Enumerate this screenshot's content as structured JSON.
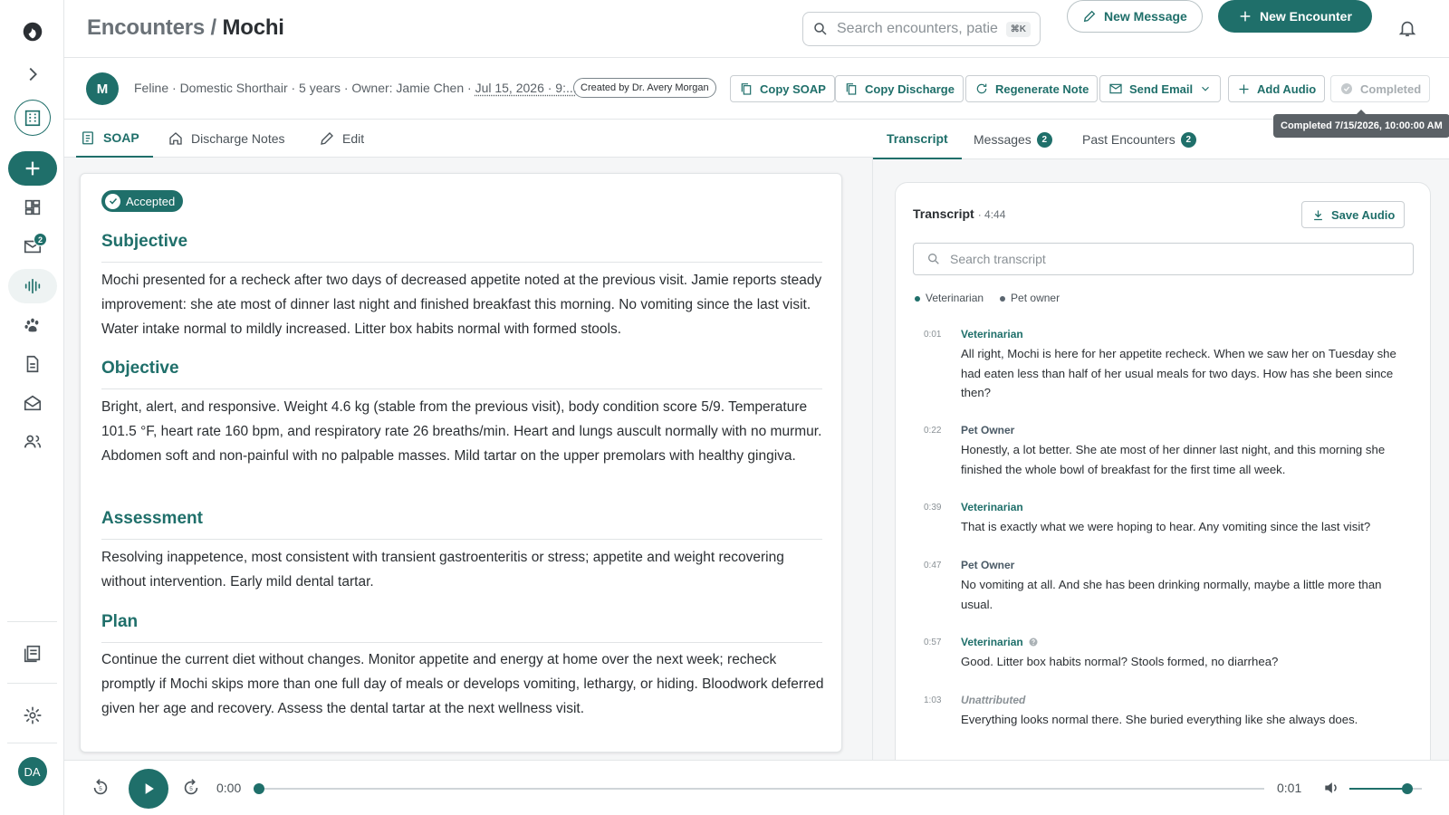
{
  "app": {
    "badge_inbox": "2",
    "user_initials": "DA",
    "accent_color": "#1f6f6a"
  },
  "header": {
    "breadcrumb_parent": "Encounters",
    "breadcrumb_sep": " / ",
    "breadcrumb_current": "Mochi",
    "search_placeholder": "Search encounters, patients...",
    "search_shortcut": "⌘K",
    "new_message_label": "New Message",
    "new_encounter_label": "New Encounter"
  },
  "patient": {
    "avatar_initial": "M",
    "summary": "Feline · Domestic Shorthair · 5 years · Owner: Jamie Chen ·",
    "date": "Jul 15, 2026 · 9:...",
    "created_by": "Created by Dr. Avery Morgan"
  },
  "actions": {
    "copy_soap": "Copy SOAP",
    "copy_discharge": "Copy Discharge",
    "regenerate_note": "Regenerate Note",
    "send_email": "Send Email",
    "add_audio": "Add Audio",
    "completed": "Completed",
    "completed_tooltip": "Completed 7/15/2026, 10:00:00 AM"
  },
  "left_tabs": [
    {
      "label": "SOAP",
      "icon": "clipboard-icon"
    },
    {
      "label": "Discharge Notes",
      "icon": "home-icon"
    },
    {
      "label": "Edit",
      "icon": "pencil-icon"
    }
  ],
  "soap": {
    "status": "Accepted",
    "sections": [
      {
        "title": "Subjective",
        "body": "Mochi presented for a recheck after two days of decreased appetite noted at the previous visit. Jamie reports steady improvement: she ate most of dinner last night and finished breakfast this morning. No vomiting since the last visit. Water intake normal to mildly increased. Litter box habits normal with formed stools."
      },
      {
        "title": "Objective",
        "body": "Bright, alert, and responsive. Weight 4.6 kg (stable from the previous visit), body condition score 5/9. Temperature 101.5 °F, heart rate 160 bpm, and respiratory rate 26 breaths/min. Heart and lungs auscult normally with no murmur. Abdomen soft and non-painful with no palpable masses. Mild tartar on the upper premolars with healthy gingiva."
      },
      {
        "title": "Assessment",
        "body": "Resolving inappetence, most consistent with transient gastroenteritis or stress; appetite and weight recovering without intervention. Early mild dental tartar."
      },
      {
        "title": "Plan",
        "body": "Continue the current diet without changes. Monitor appetite and energy at home over the next week; recheck promptly if Mochi skips more than one full day of meals or develops vomiting, lethargy, or hiding. Bloodwork deferred given her age and recovery. Assess the dental tartar at the next wellness visit."
      }
    ]
  },
  "right_tabs": [
    {
      "label": "Transcript"
    },
    {
      "label": "Messages",
      "count": "2"
    },
    {
      "label": "Past Encounters",
      "count": "2"
    }
  ],
  "transcript": {
    "title": "Transcript",
    "duration": "· 4:44",
    "save_audio_label": "Save Audio",
    "search_placeholder": "Search transcript",
    "legend": [
      {
        "label": "Veterinarian",
        "color": "#1f6f6a"
      },
      {
        "label": "Pet owner",
        "color": "#5b6670"
      }
    ],
    "utterances": [
      {
        "time": "0:01",
        "speaker": "Veterinarian",
        "text": "All right, Mochi is here for her appetite recheck. When we saw her on Tuesday she had eaten less than half of her usual meals for two days. How has she been since then?"
      },
      {
        "time": "0:22",
        "speaker": "Pet Owner",
        "text": "Honestly, a lot better. She ate most of her dinner last night, and this morning she finished the whole bowl of breakfast for the first time all week."
      },
      {
        "time": "0:39",
        "speaker": "Veterinarian",
        "text": "That is exactly what we were hoping to hear. Any vomiting since the last visit?"
      },
      {
        "time": "0:47",
        "speaker": "Pet Owner",
        "text": "No vomiting at all. And she has been drinking normally, maybe a little more than usual."
      },
      {
        "time": "0:57",
        "speaker": "Veterinarian",
        "text": "Good. Litter box habits normal? Stools formed, no diarrhea?"
      },
      {
        "time": "1:03",
        "speaker": "Unattributed",
        "text": "Everything looks normal there. She buried everything like she always does."
      }
    ]
  },
  "player": {
    "current_time": "0:00",
    "total_time": "0:01",
    "progress": 0.0,
    "volume": 0.8
  }
}
